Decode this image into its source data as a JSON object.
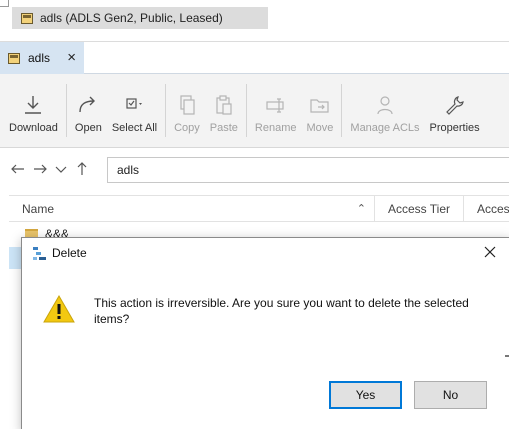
{
  "explorer": {
    "selected_item": "adls (ADLS Gen2, Public, Leased)"
  },
  "tabs": [
    {
      "label": "adls",
      "close": "×"
    }
  ],
  "toolbar": {
    "buttons": [
      {
        "id": "download",
        "label": "Download",
        "icon": "download-icon",
        "enabled": true
      },
      {
        "id": "open",
        "label": "Open",
        "icon": "open-arrow-icon",
        "enabled": true
      },
      {
        "id": "select_all",
        "label": "Select All",
        "icon": "select-all-icon",
        "enabled": true
      },
      {
        "id": "copy",
        "label": "Copy",
        "icon": "copy-icon",
        "enabled": false
      },
      {
        "id": "paste",
        "label": "Paste",
        "icon": "paste-icon",
        "enabled": false
      },
      {
        "id": "rename",
        "label": "Rename",
        "icon": "rename-icon",
        "enabled": false
      },
      {
        "id": "move",
        "label": "Move",
        "icon": "move-icon",
        "enabled": false
      },
      {
        "id": "manage_acls",
        "label": "Manage ACLs",
        "icon": "user-icon",
        "enabled": false
      },
      {
        "id": "properties",
        "label": "Properties",
        "icon": "wrench-icon",
        "enabled": true
      }
    ]
  },
  "address": {
    "path": "adls"
  },
  "columns": {
    "name": "Name",
    "access_tier": "Access Tier",
    "access": "Access"
  },
  "rows": [
    {
      "name": "&&&"
    }
  ],
  "dialog": {
    "title": "Delete",
    "message": "This action is irreversible. Are you sure you want to delete the selected items?",
    "yes_label": "Yes",
    "no_label": "No"
  },
  "colors": {
    "tab_active": "#d6e4f2",
    "selection": "#cce4f7",
    "default_button_border": "#0078d7",
    "warning": "#f2c811"
  }
}
